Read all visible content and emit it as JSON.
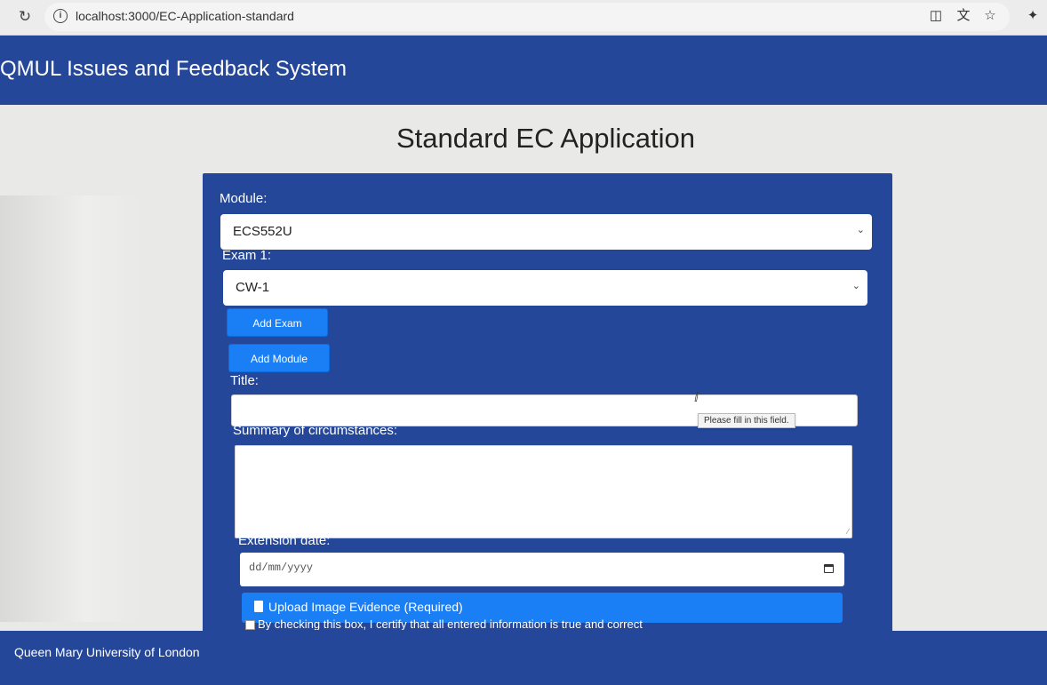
{
  "browser": {
    "url": "localhost:3000/EC-Application-standard"
  },
  "header": {
    "title": "QMUL Issues and Feedback System"
  },
  "page": {
    "title": "Standard EC Application"
  },
  "form": {
    "module_label": "Module:",
    "module_value": "ECS552U",
    "exam_label": "Exam 1:",
    "exam_value": "CW-1",
    "add_exam_label": "Add Exam",
    "add_module_label": "Add Module",
    "title_label": "Title:",
    "title_value": "",
    "validation_tooltip": "Please fill in this field.",
    "summary_label": "Summary of circumstances:",
    "summary_value": "",
    "extension_label": "Extension date:",
    "extension_placeholder": "dd/mm/yyyy",
    "upload_label": "Upload Image Evidence (Required)",
    "certify_label": "By checking this box, I certify that all entered information is true and correct"
  },
  "footer": {
    "text": "Queen Mary University of London"
  },
  "colors": {
    "brand_blue": "#24479a",
    "button_blue": "#1a7ef5"
  }
}
